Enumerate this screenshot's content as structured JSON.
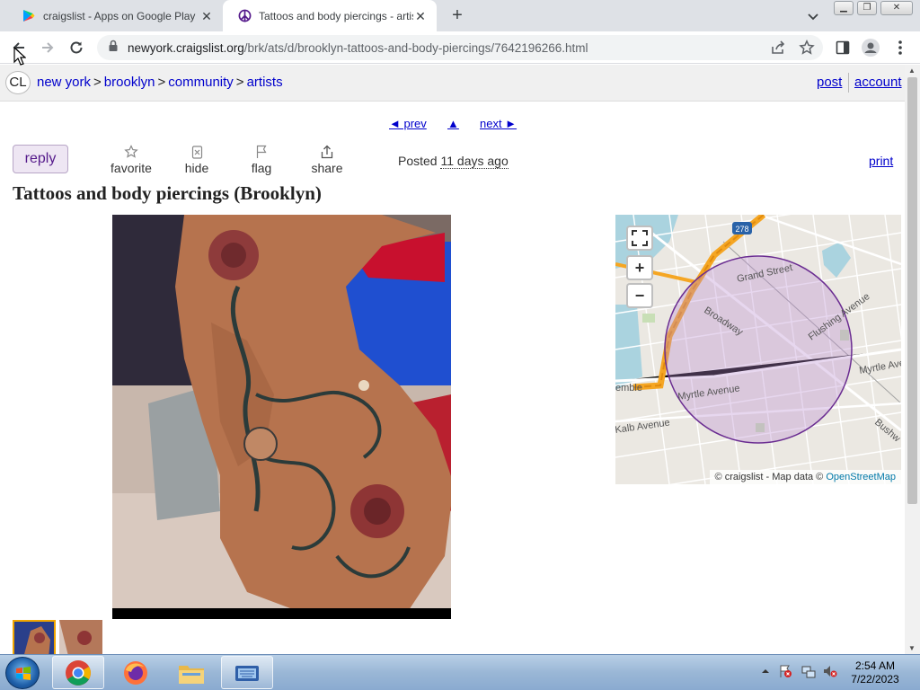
{
  "browser": {
    "tabs": [
      {
        "title": "craigslist - Apps on Google Play",
        "active": false
      },
      {
        "title": "Tattoos and body piercings - artis",
        "active": true
      }
    ],
    "url": {
      "host": "newyork.craigslist.org",
      "path": "/brk/ats/d/brooklyn-tattoos-and-body-piercings/7642196266.html"
    }
  },
  "page": {
    "logo": "CL",
    "breadcrumbs": [
      "new york",
      "brooklyn",
      "community",
      "artists"
    ],
    "breadcrumb_sep": ">",
    "header_links": {
      "post": "post",
      "account": "account"
    },
    "pager": {
      "prev": "◄ prev",
      "up": "▲",
      "next": "next ►"
    },
    "actions": {
      "reply": "reply",
      "favorite": "favorite",
      "hide": "hide",
      "flag": "flag",
      "share": "share"
    },
    "posted_label": "Posted",
    "posted_ago": "11 days ago",
    "print": "print",
    "title": "Tattoos and body piercings (Brooklyn)",
    "map": {
      "streets": [
        "Grand Street",
        "Broadway",
        "Flushing Avenue",
        "Myrtle Ave",
        "Myrtle Avenue",
        "Kalb Avenue",
        "Bushw",
        "emble",
        "278"
      ],
      "zoom_in": "+",
      "zoom_out": "−",
      "attribution_prefix": "© craigslist - Map data ©",
      "attribution_link": "OpenStreetMap"
    }
  },
  "taskbar": {
    "time": "2:54 AM",
    "date": "7/22/2023"
  },
  "colors": {
    "link": "#0000cc",
    "reply_bg": "#eee6f3",
    "map_circle": "#6a2c91"
  }
}
